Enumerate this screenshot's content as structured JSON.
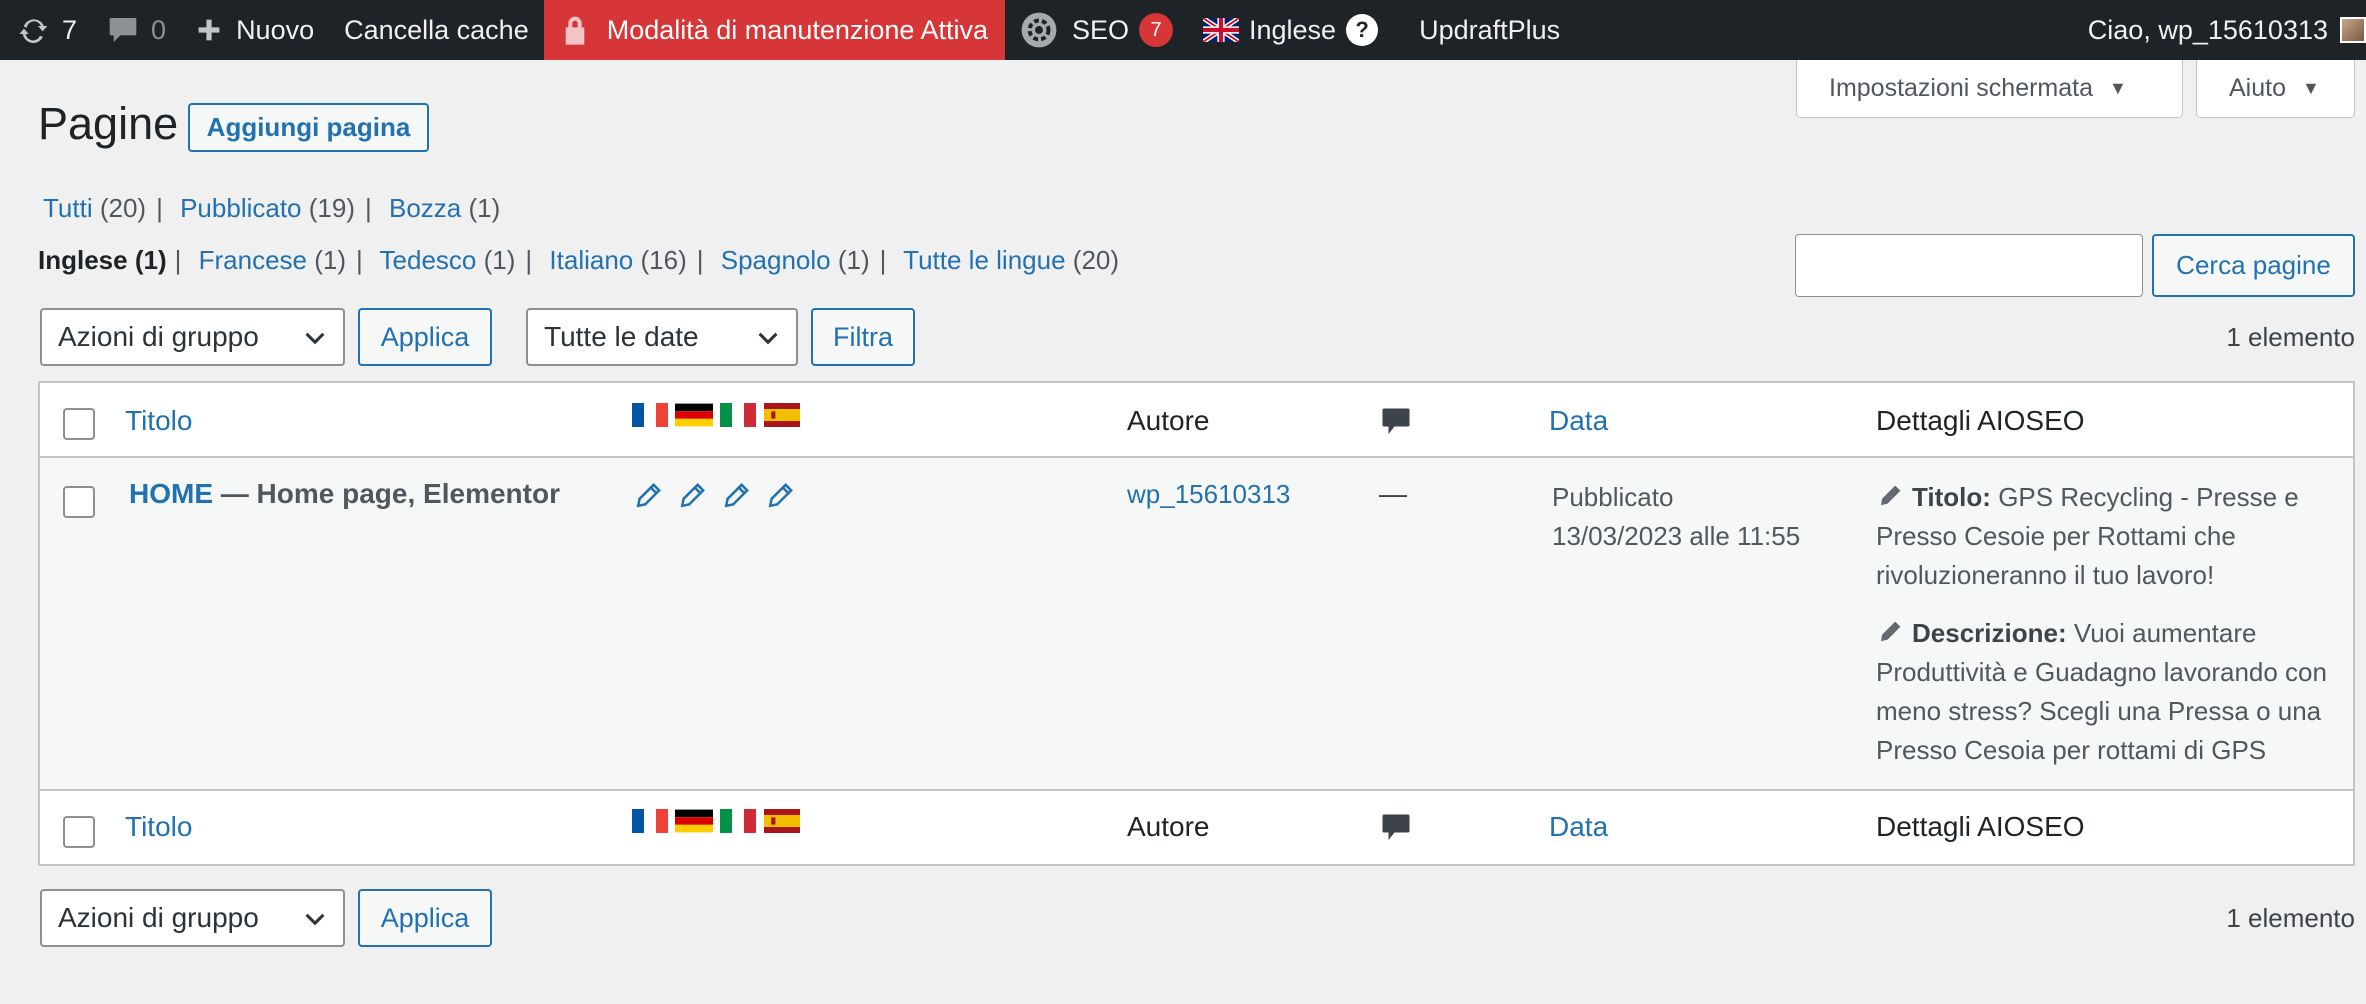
{
  "adminbar": {
    "updates_count": "7",
    "comments_count": "0",
    "new_label": "Nuovo",
    "clear_cache_label": "Cancella cache",
    "maintenance_label": "Modalità di manutenzione Attiva",
    "seo_label": "SEO",
    "seo_badge": "7",
    "language_label": "Inglese",
    "help_glyph": "?",
    "updraft_label": "UpdraftPlus",
    "greeting": "Ciao, wp_15610313"
  },
  "screen_meta": {
    "options_label": "Impostazioni schermata",
    "help_label": "Aiuto",
    "arrow": "▼"
  },
  "page": {
    "title": "Pagine",
    "add_button": "Aggiungi pagina"
  },
  "status_filters": [
    {
      "label": "Tutti",
      "count": "(20)"
    },
    {
      "label": "Pubblicato",
      "count": "(19)"
    },
    {
      "label": "Bozza",
      "count": "(1)"
    }
  ],
  "language_filters": [
    {
      "label": "Inglese",
      "count": "(1)",
      "current": true
    },
    {
      "label": "Francese",
      "count": "(1)"
    },
    {
      "label": "Tedesco",
      "count": "(1)"
    },
    {
      "label": "Italiano",
      "count": "(16)"
    },
    {
      "label": "Spagnolo",
      "count": "(1)"
    },
    {
      "label": "Tutte le lingue",
      "count": "(20)"
    }
  ],
  "search": {
    "value": "",
    "button_label": "Cerca pagine"
  },
  "tablenav_top": {
    "bulk_select": "Azioni di gruppo",
    "apply_label": "Applica",
    "date_select": "Tutte le date",
    "filter_label": "Filtra",
    "items_count": "1 elemento"
  },
  "tablenav_bottom": {
    "bulk_select": "Azioni di gruppo",
    "apply_label": "Applica",
    "items_count": "1 elemento"
  },
  "columns": {
    "title": "Titolo",
    "author": "Autore",
    "date": "Data",
    "aioseo": "Dettagli AIOSEO"
  },
  "rows": [
    {
      "title_link": "HOME",
      "title_suffix": " — Home page, Elementor",
      "author": "wp_15610313",
      "comments": "—",
      "date_status": "Pubblicato",
      "date_value": "13/03/2023 alle 11:55",
      "seo_title_label": "Titolo:",
      "seo_title": "GPS Recycling - Presse e Presso Cesoie per Rottami che rivoluzioneranno il tuo lavoro!",
      "seo_desc_label": "Descrizione:",
      "seo_desc": "Vuoi aumentare Produttività e Guadagno lavorando con meno stress? Scegli una Pressa o una Presso Cesoia per rottami di GPS"
    }
  ],
  "colors": {
    "adminbar_bg": "#1d2327",
    "maintenance_bg": "#d63638",
    "link": "#2271b1",
    "page_bg": "#f0f0f1"
  }
}
